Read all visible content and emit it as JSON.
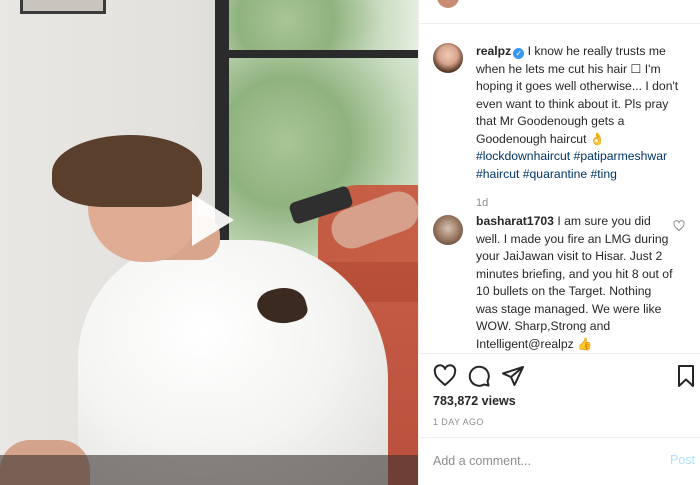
{
  "post": {
    "author": "realpz",
    "caption": "I know he really trusts me when he lets me cut his hair ☐ I'm hoping it goes well otherwise... I don't even want to think about it. Pls pray that Mr Goodenough gets a Goodenough haircut 👌",
    "hashtags_line1": "#lockdownhaircut #patiparmeshwar",
    "hashtags_line2_a": "#haircut #quarantine #ting",
    "time": "1d"
  },
  "comment": {
    "author": "basharat1703",
    "text": "I am sure you did well. I made you fire an LMG during your JaiJawan visit to Hisar. Just 2 minutes briefing, and you hit 8 out of 10 bullets on the Target. Nothing was stage managed. We were like WOW. Sharp,Strong and Intelligent@realpz 👍"
  },
  "stats": {
    "views": "783,872 views",
    "posted": "1 DAY AGO"
  },
  "add_comment": {
    "placeholder": "Add a comment...",
    "post_label": "Post"
  },
  "icons": {
    "play": "play-icon",
    "like": "heart-icon",
    "comment": "comment-icon",
    "share": "paper-plane-icon",
    "save": "bookmark-icon",
    "verified": "verified-badge-icon"
  },
  "colors": {
    "link": "#003569",
    "muted": "#8e8e8e",
    "verified": "#3897f0",
    "post_disabled": "#b2dffc"
  }
}
